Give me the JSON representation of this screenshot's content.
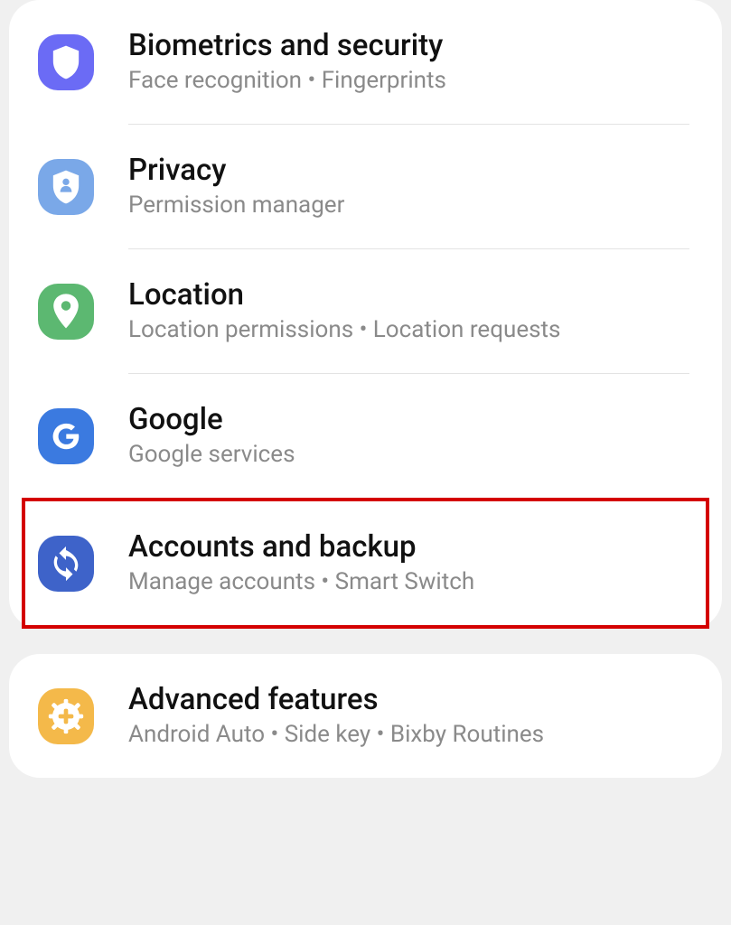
{
  "settings": {
    "group1": [
      {
        "title": "Biometrics and security",
        "subtitle": "Face recognition  •  Fingerprints",
        "icon": "shield-icon",
        "bg": "#6b6bf5"
      },
      {
        "title": "Privacy",
        "subtitle": "Permission manager",
        "icon": "privacy-shield-icon",
        "bg": "#7aa8e8"
      },
      {
        "title": "Location",
        "subtitle": "Location permissions  •  Location requests",
        "icon": "location-pin-icon",
        "bg": "#5cb871"
      },
      {
        "title": "Google",
        "subtitle": "Google services",
        "icon": "google-g-icon",
        "bg": "#3b7ae0"
      },
      {
        "title": "Accounts and backup",
        "subtitle": "Manage accounts  •  Smart Switch",
        "icon": "sync-icon",
        "bg": "#3e63c9",
        "highlighted": true
      }
    ],
    "group2": [
      {
        "title": "Advanced features",
        "subtitle": "Android Auto  •  Side key  •  Bixby Routines",
        "icon": "plus-gear-icon",
        "bg": "#f4b94a"
      }
    ]
  }
}
